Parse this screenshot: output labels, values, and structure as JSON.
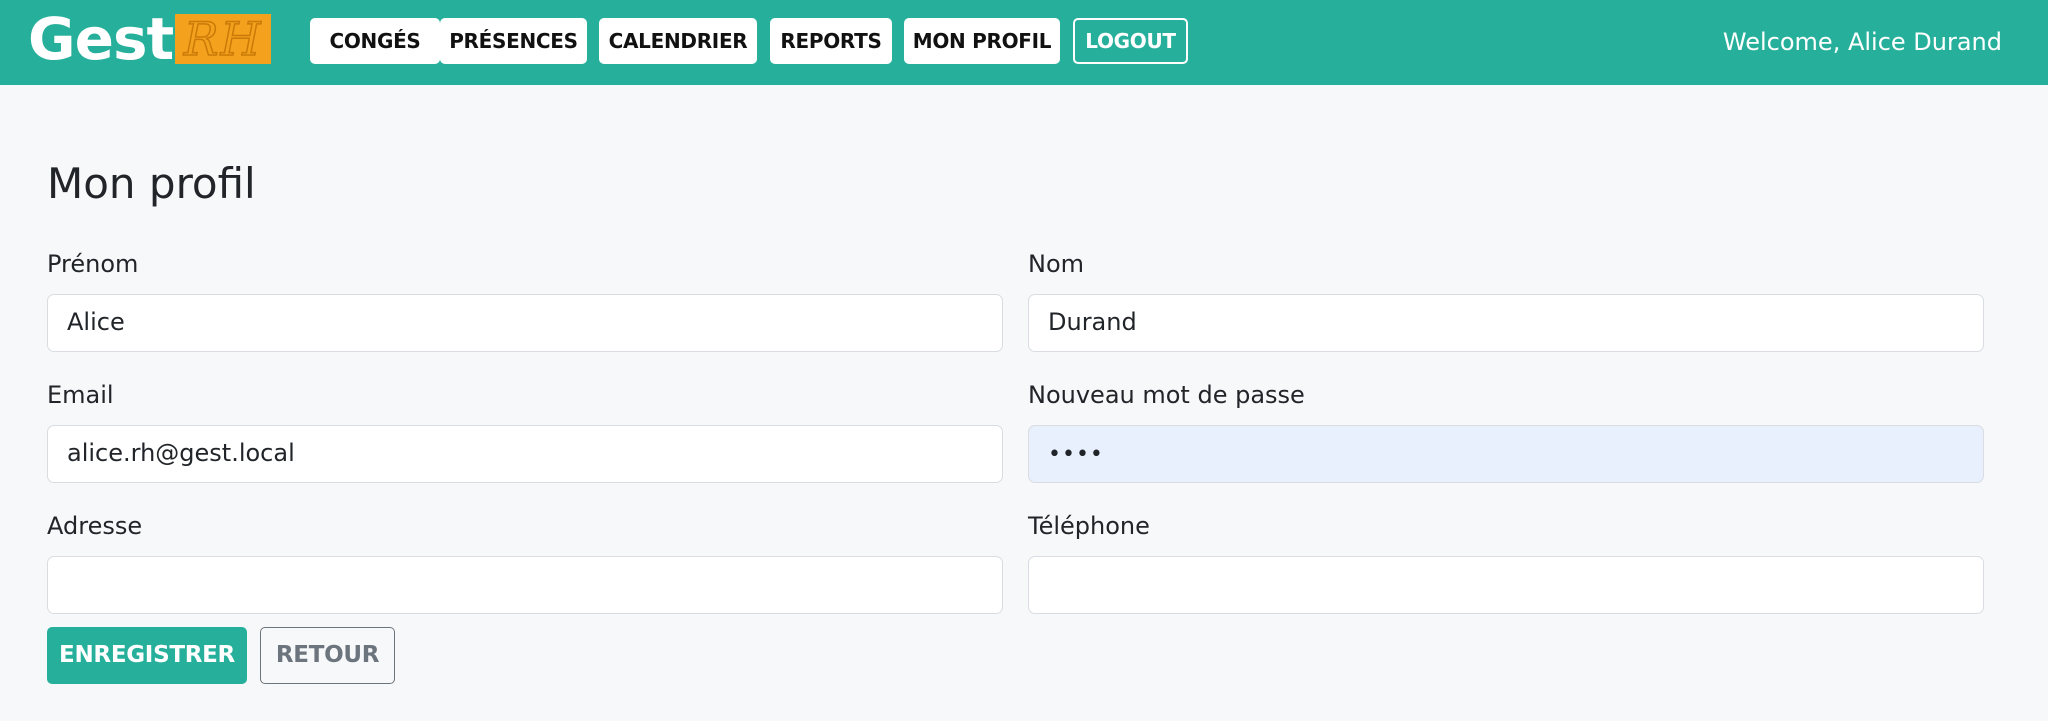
{
  "header": {
    "logo_text": "Gest",
    "logo_badge": "RH",
    "nav": [
      {
        "label": "CONGÉS"
      },
      {
        "label": "PRÉSENCES"
      },
      {
        "label": "CALENDRIER"
      },
      {
        "label": "REPORTS"
      },
      {
        "label": "MON PROFIL"
      },
      {
        "label": "LOGOUT"
      }
    ],
    "welcome": "Welcome, Alice Durand"
  },
  "page": {
    "title": "Mon profil"
  },
  "form": {
    "prenom": {
      "label": "Prénom",
      "value": "Alice"
    },
    "nom": {
      "label": "Nom",
      "value": "Durand"
    },
    "email": {
      "label": "Email",
      "value": "alice.rh@gest.local"
    },
    "password": {
      "label": "Nouveau mot de passe",
      "value": "••••"
    },
    "adresse": {
      "label": "Adresse",
      "value": ""
    },
    "telephone": {
      "label": "Téléphone",
      "value": ""
    },
    "save_label": "ENREGISTRER",
    "back_label": "RETOUR"
  },
  "colors": {
    "brand": "#26b09b",
    "logo_accent": "#f4a11e",
    "autofill_bg": "#e8f0fe",
    "secondary": "#6c757d"
  }
}
